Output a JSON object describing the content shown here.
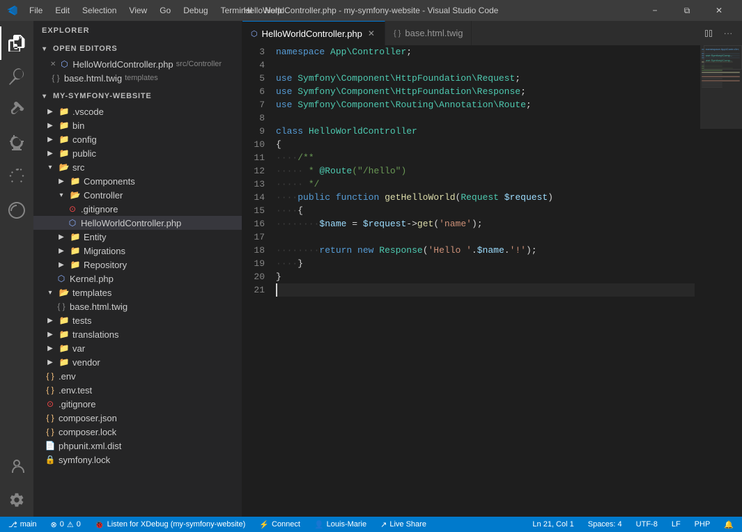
{
  "titleBar": {
    "title": "HelloWorldController.php - my-symfony-website - Visual Studio Code",
    "menuItems": [
      "File",
      "Edit",
      "Selection",
      "View",
      "Go",
      "Debug",
      "Terminal",
      "Help"
    ],
    "controls": [
      "−",
      "❐",
      "✕"
    ]
  },
  "activityBar": {
    "items": [
      {
        "name": "explorer",
        "icon": "files",
        "active": true
      },
      {
        "name": "search",
        "icon": "search"
      },
      {
        "name": "source-control",
        "icon": "git"
      },
      {
        "name": "debug",
        "icon": "debug"
      },
      {
        "name": "extensions",
        "icon": "extensions"
      },
      {
        "name": "remote-explorer",
        "icon": "remote"
      },
      {
        "name": "accounts",
        "icon": "accounts"
      },
      {
        "name": "settings",
        "icon": "settings"
      }
    ]
  },
  "sidebar": {
    "header": "Explorer",
    "sections": {
      "openEditors": {
        "label": "Open Editors",
        "items": [
          {
            "name": "HelloWorldController.php",
            "path": "src/Controller",
            "type": "php",
            "active": true,
            "modified": false
          },
          {
            "name": "base.html.twig",
            "path": "templates",
            "type": "twig",
            "active": false
          }
        ]
      },
      "projectRoot": {
        "label": "MY-SYMFONY-WEBSITE",
        "tree": [
          {
            "name": ".vscode",
            "type": "folder",
            "indent": 1,
            "expanded": false
          },
          {
            "name": "bin",
            "type": "folder",
            "indent": 1,
            "expanded": false
          },
          {
            "name": "config",
            "type": "folder",
            "indent": 1,
            "expanded": false
          },
          {
            "name": "public",
            "type": "folder",
            "indent": 1,
            "expanded": false
          },
          {
            "name": "src",
            "type": "folder",
            "indent": 1,
            "expanded": true
          },
          {
            "name": "Components",
            "type": "folder",
            "indent": 2,
            "expanded": false
          },
          {
            "name": "Controller",
            "type": "folder",
            "indent": 2,
            "expanded": true
          },
          {
            "name": ".gitignore",
            "type": "git",
            "indent": 3
          },
          {
            "name": "HelloWorldController.php",
            "type": "php",
            "indent": 3,
            "active": true
          },
          {
            "name": "Entity",
            "type": "folder",
            "indent": 2,
            "expanded": false
          },
          {
            "name": "Migrations",
            "type": "folder",
            "indent": 2,
            "expanded": false
          },
          {
            "name": "Repository",
            "type": "folder",
            "indent": 2,
            "expanded": false
          },
          {
            "name": "Kernel.php",
            "type": "php",
            "indent": 2
          },
          {
            "name": "templates",
            "type": "folder",
            "indent": 1,
            "expanded": true
          },
          {
            "name": "base.html.twig",
            "type": "twig",
            "indent": 2
          },
          {
            "name": "tests",
            "type": "folder",
            "indent": 1,
            "expanded": false
          },
          {
            "name": "translations",
            "type": "folder",
            "indent": 1,
            "expanded": false
          },
          {
            "name": "var",
            "type": "folder",
            "indent": 1,
            "expanded": false
          },
          {
            "name": "vendor",
            "type": "folder",
            "indent": 1,
            "expanded": false
          },
          {
            "name": ".env",
            "type": "env",
            "indent": 1
          },
          {
            "name": ".env.test",
            "type": "env",
            "indent": 1
          },
          {
            "name": ".gitignore",
            "type": "git",
            "indent": 1
          },
          {
            "name": "composer.json",
            "type": "json",
            "indent": 1
          },
          {
            "name": "composer.lock",
            "type": "json",
            "indent": 1
          },
          {
            "name": "phpunit.xml.dist",
            "type": "xml",
            "indent": 1
          },
          {
            "name": "symfony.lock",
            "type": "lock",
            "indent": 1
          }
        ]
      }
    }
  },
  "tabs": [
    {
      "label": "HelloWorldController.php",
      "active": true,
      "type": "php"
    },
    {
      "label": "base.html.twig",
      "active": false,
      "type": "twig"
    }
  ],
  "editor": {
    "filename": "HelloWorldController.php",
    "language": "PHP",
    "encoding": "UTF-8",
    "lineEnding": "LF",
    "cursor": {
      "line": 21,
      "col": 1
    },
    "indentSize": 4,
    "indentType": "Spaces"
  },
  "codeLines": [
    {
      "num": 3,
      "content": "namespace App\\Controller;"
    },
    {
      "num": 4,
      "content": ""
    },
    {
      "num": 5,
      "content": "use Symfony\\Component\\HttpFoundation\\Request;"
    },
    {
      "num": 6,
      "content": "use Symfony\\Component\\HttpFoundation\\Response;"
    },
    {
      "num": 7,
      "content": "use Symfony\\Component\\Routing\\Annotation\\Route;"
    },
    {
      "num": 8,
      "content": ""
    },
    {
      "num": 9,
      "content": "class HelloWorldController"
    },
    {
      "num": 10,
      "content": "{"
    },
    {
      "num": 11,
      "content": "    /**"
    },
    {
      "num": 12,
      "content": "     * @Route(\"/hello\")"
    },
    {
      "num": 13,
      "content": "     */"
    },
    {
      "num": 14,
      "content": "    public function getHelloWorld(Request $request)"
    },
    {
      "num": 15,
      "content": "    {"
    },
    {
      "num": 16,
      "content": "        $name = $request->get('name');"
    },
    {
      "num": 17,
      "content": ""
    },
    {
      "num": 18,
      "content": "        return new Response('Hello '.$name.'!');"
    },
    {
      "num": 19,
      "content": "    }"
    },
    {
      "num": 20,
      "content": "}"
    },
    {
      "num": 21,
      "content": ""
    }
  ],
  "statusBar": {
    "branch": "main",
    "errors": 0,
    "warnings": 0,
    "xdebug": "Listen for XDebug (my-symfony-website)",
    "connect": "Connect",
    "user": "Louis-Marie",
    "liveShare": "Live Share",
    "cursorInfo": "Ln 21, Col 1",
    "spaces": "Spaces: 4",
    "encoding": "UTF-8",
    "lineEnding": "LF",
    "language": "PHP",
    "notifications": "🔔"
  }
}
